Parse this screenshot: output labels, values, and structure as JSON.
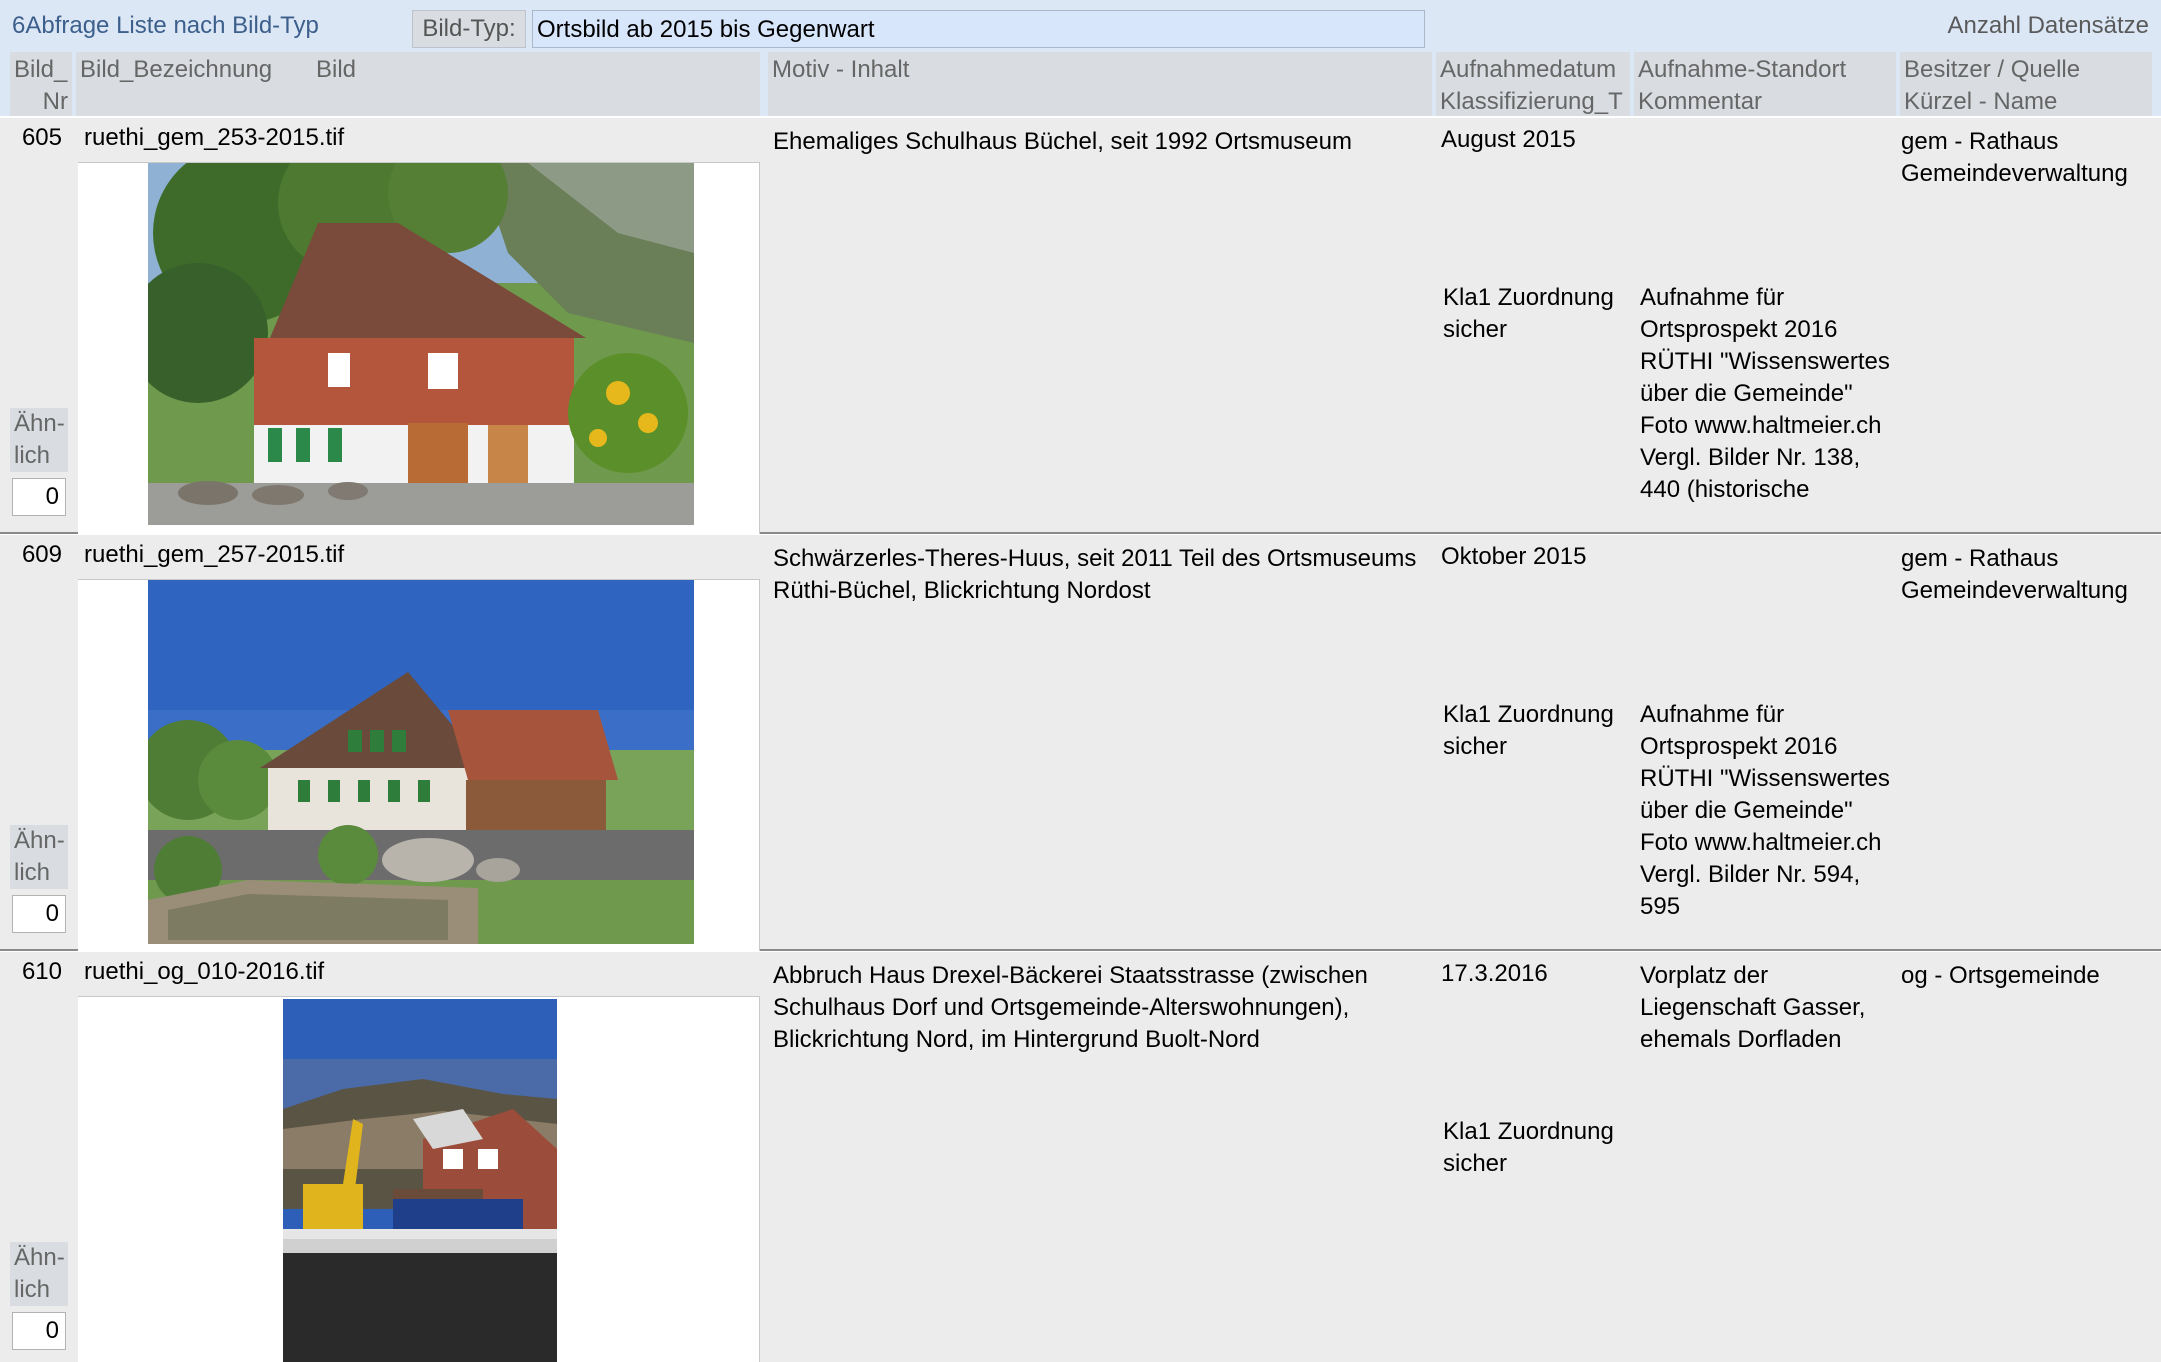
{
  "header": {
    "title": "6Abfrage Liste nach Bild-Typ",
    "filter_label": "Bild-Typ:",
    "filter_value": "Ortsbild ab 2015 bis Gegenwart",
    "count_label": "Anzahl Datensätze"
  },
  "columns": {
    "nr_line1": "Bild_",
    "nr_line2": "Nr",
    "bezeichnung": "Bild_Bezeichnung",
    "bild": "Bild",
    "motiv": "Motiv - Inhalt",
    "datum_line1": "Aufnahmedatum",
    "datum_line2": "Klassifizierung_T",
    "standort_line1": "Aufnahme-Standort",
    "standort_line2": "Kommentar",
    "besitzer_line1": "Besitzer / Quelle",
    "besitzer_line2": "Kürzel - Name"
  },
  "records": [
    {
      "nr": "605",
      "filename": "ruethi_gem_253-2015.tif",
      "motiv": "Ehemaliges Schulhaus Büchel, seit 1992 Ortsmuseum",
      "datum": "August 2015",
      "klassifizierung": "Kla1 Zuordnung sicher",
      "standort": "",
      "kommentar": "Aufnahme für Ortsprospekt 2016 RÜTHI \"Wissenswertes über die Gemeinde\" Foto www.haltmeier.ch Vergl. Bilder Nr. 138, 440 (historische",
      "besitzer": "gem - Rathaus Gemeindeverwaltung",
      "aehnlich_label": "Ähn-lich",
      "aehnlich_value": "0"
    },
    {
      "nr": "609",
      "filename": "ruethi_gem_257-2015.tif",
      "motiv": "Schwärzerles-Theres-Huus, seit 2011 Teil des Ortsmuseums Rüthi-Büchel, Blickrichtung Nordost",
      "datum": "Oktober 2015",
      "klassifizierung": "Kla1 Zuordnung sicher",
      "standort": "",
      "kommentar": "Aufnahme für Ortsprospekt 2016 RÜTHI \"Wissenswertes über die Gemeinde\" Foto www.haltmeier.ch Vergl. Bilder Nr. 594, 595",
      "besitzer": "gem - Rathaus Gemeindeverwaltung",
      "aehnlich_label": "Ähn-lich",
      "aehnlich_value": "0"
    },
    {
      "nr": "610",
      "filename": "ruethi_og_010-2016.tif",
      "motiv": "Abbruch Haus Drexel-Bäckerei Staatsstrasse (zwischen Schulhaus Dorf und Ortsgemeinde-Alterswohnungen), Blickrichtung Nord, im Hintergrund Buolt-Nord",
      "datum": "17.3.2016",
      "klassifizierung": "Kla1 Zuordnung sicher",
      "standort": "Vorplatz der Liegenschaft Gasser, ehemals Dorfladen",
      "kommentar": "",
      "besitzer": "og -  Ortsgemeinde",
      "aehnlich_label": "Ähn-lich",
      "aehnlich_value": "0"
    }
  ]
}
